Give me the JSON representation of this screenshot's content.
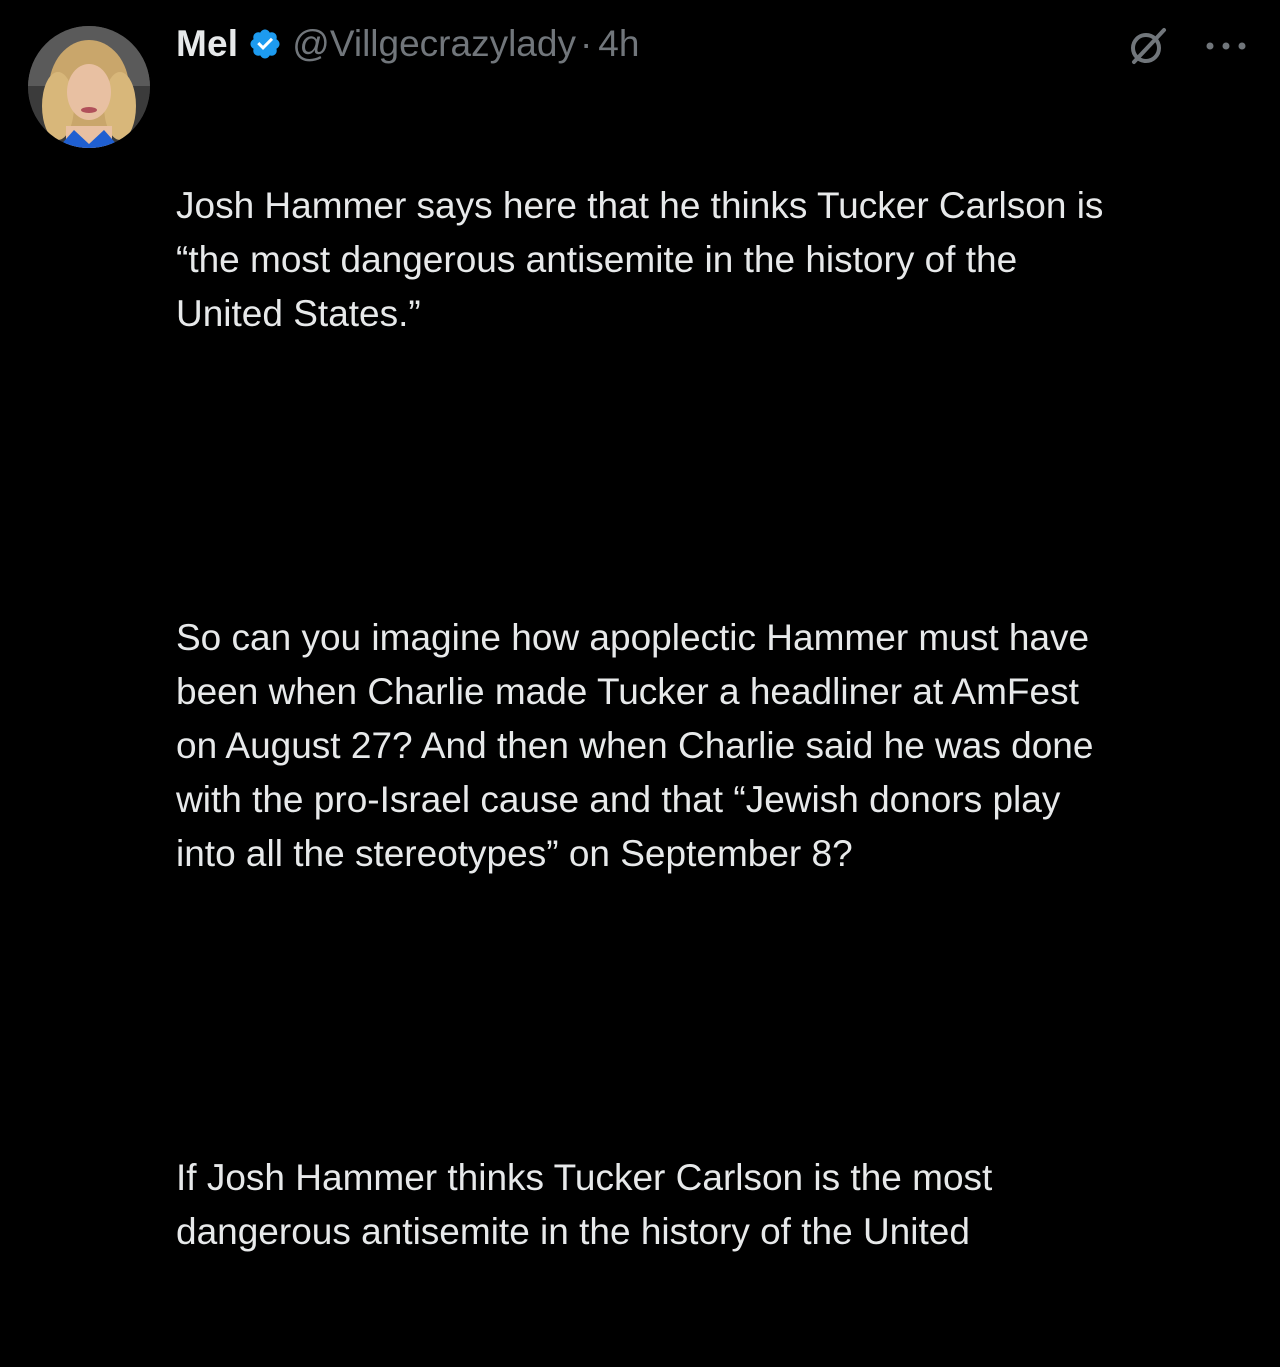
{
  "tweet": {
    "author": {
      "display_name": "Mel",
      "handle": "@Villgecrazylady",
      "verified": true,
      "avatar_icon": "profile-photo"
    },
    "separator": "·",
    "time": "4h",
    "icons": {
      "grok": "grok-icon",
      "more": "more-options-icon",
      "verified": "verified-badge-icon"
    },
    "colors": {
      "background": "#000000",
      "text": "#e7e9ea",
      "secondary_text": "#71767b",
      "verified_blue": "#1d9bf0"
    },
    "paragraphs": [
      "Josh Hammer says here that he thinks Tucker Carlson is\n“the most dangerous antisemite in the history of the\nUnited States.”",
      "So can you imagine how apoplectic Hammer must have\nbeen when Charlie made Tucker a headliner at AmFest\non August 27? And then when Charlie said he was done\nwith the pro-Israel cause and that “Jewish donors play\ninto all the stereotypes” on September 8?",
      "If Josh Hammer thinks Tucker Carlson is the most\ndangerous antisemite in the history of the United"
    ]
  }
}
